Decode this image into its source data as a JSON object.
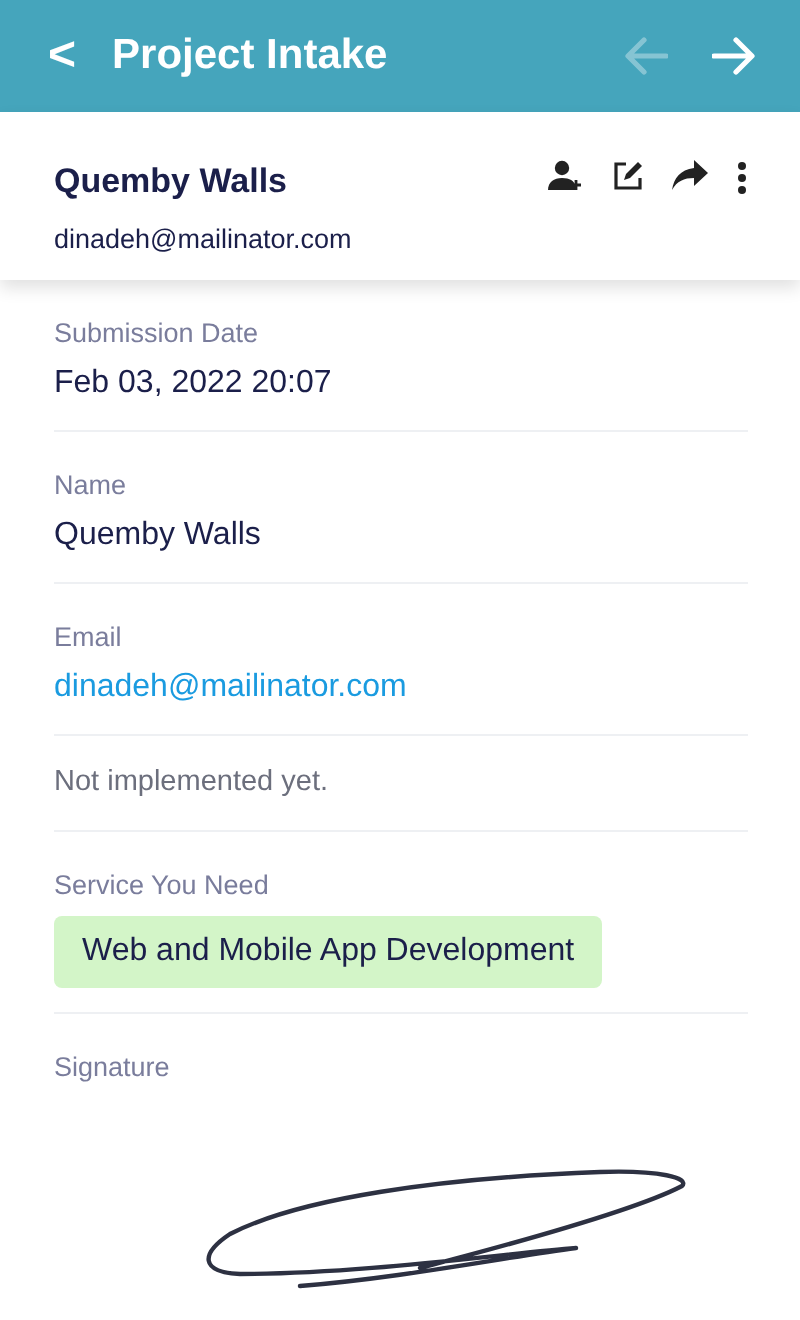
{
  "app_bar": {
    "title": "Project Intake",
    "back": "<",
    "prev_disabled": true,
    "next_disabled": false
  },
  "submitter": {
    "name": "Quemby Walls",
    "email": "dinadeh@mailinator.com"
  },
  "fields": [
    {
      "kind": "text",
      "label": "Submission Date",
      "value": "Feb 03, 2022 20:07"
    },
    {
      "kind": "text",
      "label": "Name",
      "value": "Quemby Walls"
    },
    {
      "kind": "link",
      "label": "Email",
      "value": "dinadeh@mailinator.com"
    },
    {
      "kind": "note",
      "value": "Not implemented yet."
    },
    {
      "kind": "tag",
      "label": "Service You Need",
      "value": "Web and Mobile App Development",
      "color": "#d3f5c8"
    },
    {
      "kind": "signature",
      "label": "Signature"
    }
  ]
}
